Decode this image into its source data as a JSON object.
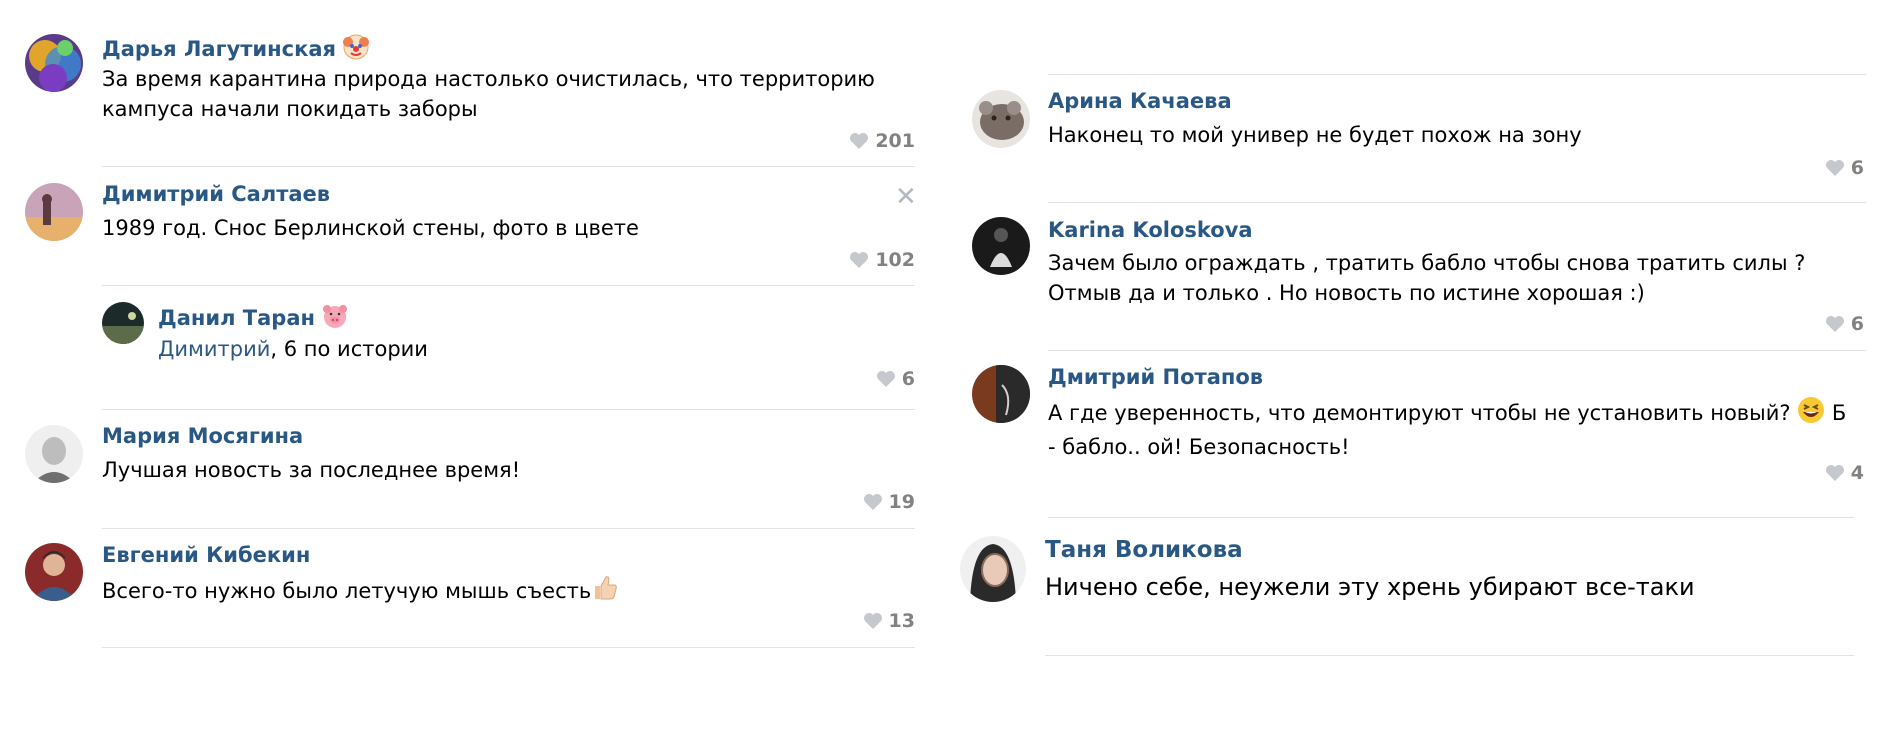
{
  "left_comments": [
    {
      "author": "Дарья Лагутинская",
      "author_emoji": "clown-face-emoji",
      "text": "За время карантина природа настолько очистилась, что территорию кампуса начали покидать заборы",
      "likes": "201",
      "avatar_colors": [
        "#7a3cc1",
        "#e0a52b",
        "#3a8ad6"
      ]
    },
    {
      "author": "Димитрий Салтаев",
      "text": "1989 год. Снос Берлинской стены, фото в цвете",
      "likes": "102",
      "avatar_colors": [
        "#c9a3b7",
        "#5b3a40",
        "#e7b06c"
      ]
    },
    {
      "author": "Данил Таран",
      "author_emoji": "pig-face-emoji",
      "mention": "Димитрий",
      "text": ", 6 по истории",
      "likes": "6",
      "avatar_colors": [
        "#1d2a2a",
        "#5c6b4a",
        "#cfd6a0"
      ]
    },
    {
      "author": "Мария Мосягина",
      "text": "Лучшая новость за последнее время!",
      "likes": "19",
      "avatar_colors": [
        "#bdbdbd",
        "#efefef",
        "#6f6f6f"
      ]
    },
    {
      "author": "Евгений Кибекин",
      "text": "Всего-то нужно было летучую мышь съесть",
      "text_emoji": "thumbs-up-emoji",
      "likes": "13",
      "avatar_colors": [
        "#4a4a55",
        "#8a2a2a",
        "#3a5e8c"
      ]
    }
  ],
  "right_comments": [
    {
      "author": "Арина Качаева",
      "text": "Наконец то мой универ не будет похож на зону",
      "likes": "6",
      "avatar_colors": [
        "#5c514b",
        "#9a8f88",
        "#2a2420"
      ]
    },
    {
      "author": "Karina Koloskova",
      "text": "Зачем было ограждать , тратить бабло чтобы снова тратить силы ? Отмыв да и только . Но новость по истине хорошая :)",
      "likes": "6",
      "avatar_colors": [
        "#1a1a1a",
        "#dcdcdc",
        "#555555"
      ]
    },
    {
      "author": "Дмитрий Потапов",
      "text": "А где уверенность, что демонтируют чтобы не установить новый?",
      "text_emoji": "grinning-squinting-face-emoji",
      "text_tail": "Б - бабло.. ой! Безопасность!",
      "likes": "4",
      "avatar_colors": [
        "#7a3a1e",
        "#2a2a2a",
        "#d0d0d0"
      ]
    },
    {
      "author": "Таня Воликова",
      "text": "Ничено себе, неужели эту хрень убирают все-таки",
      "avatar_colors": [
        "#2a2a2a",
        "#f0f0f0",
        "#8b6a5a"
      ]
    }
  ],
  "colors": {
    "author": "#2a5885",
    "like": "#828282",
    "divider": "#e1e3e6",
    "heart": "#c5c8cc"
  }
}
